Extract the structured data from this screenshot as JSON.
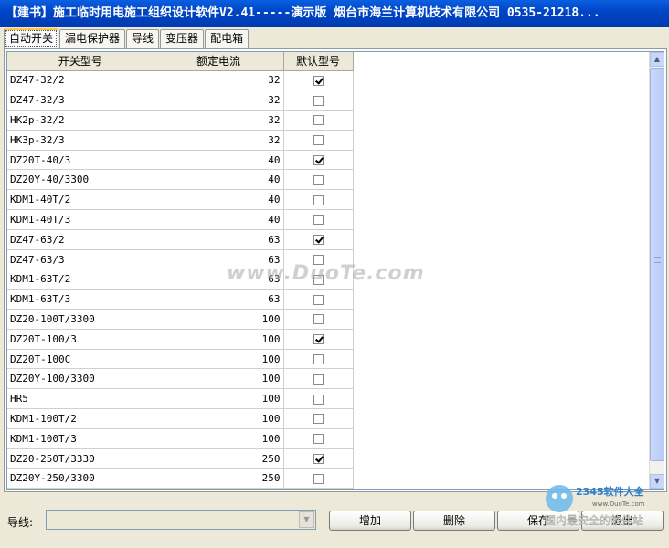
{
  "window": {
    "title": "【建书】施工临时用电施工组织设计软件V2.41-----演示版 烟台市海兰计算机技术有限公司 0535-21218..."
  },
  "tabs": [
    {
      "label": "自动开关",
      "active": true
    },
    {
      "label": "漏电保护器",
      "active": false
    },
    {
      "label": "导线",
      "active": false
    },
    {
      "label": "变压器",
      "active": false
    },
    {
      "label": "配电箱",
      "active": false
    }
  ],
  "grid": {
    "columns": [
      "开关型号",
      "额定电流",
      "默认型号"
    ],
    "rows": [
      {
        "model": "DZ47-32/2",
        "current": "32",
        "default": true
      },
      {
        "model": "DZ47-32/3",
        "current": "32",
        "default": false
      },
      {
        "model": "HK2p-32/2",
        "current": "32",
        "default": false
      },
      {
        "model": "HK3p-32/3",
        "current": "32",
        "default": false
      },
      {
        "model": "DZ20T-40/3",
        "current": "40",
        "default": true
      },
      {
        "model": "DZ20Y-40/3300",
        "current": "40",
        "default": false
      },
      {
        "model": "KDM1-40T/2",
        "current": "40",
        "default": false
      },
      {
        "model": "KDM1-40T/3",
        "current": "40",
        "default": false
      },
      {
        "model": "DZ47-63/2",
        "current": "63",
        "default": true
      },
      {
        "model": "DZ47-63/3",
        "current": "63",
        "default": false
      },
      {
        "model": "KDM1-63T/2",
        "current": "63",
        "default": false
      },
      {
        "model": "KDM1-63T/3",
        "current": "63",
        "default": false
      },
      {
        "model": "DZ20-100T/3300",
        "current": "100",
        "default": false
      },
      {
        "model": "DZ20T-100/3",
        "current": "100",
        "default": true
      },
      {
        "model": "DZ20T-100C",
        "current": "100",
        "default": false
      },
      {
        "model": "DZ20Y-100/3300",
        "current": "100",
        "default": false
      },
      {
        "model": "HR5",
        "current": "100",
        "default": false
      },
      {
        "model": "KDM1-100T/2",
        "current": "100",
        "default": false
      },
      {
        "model": "KDM1-100T/3",
        "current": "100",
        "default": false
      },
      {
        "model": "DZ20-250T/3330",
        "current": "250",
        "default": true
      },
      {
        "model": "DZ20Y-250/3300",
        "current": "250",
        "default": false
      }
    ]
  },
  "bottom": {
    "wire_label": "导线:",
    "wire_value": "",
    "buttons": {
      "add": "增加",
      "delete": "删除",
      "save": "保存",
      "exit": "退出"
    }
  },
  "watermark": "www.DuoTe.com",
  "logo_text": "2345软件大全",
  "logo_sub": "国内最安全的软件站",
  "logo_url": "www.DuoTe.com"
}
